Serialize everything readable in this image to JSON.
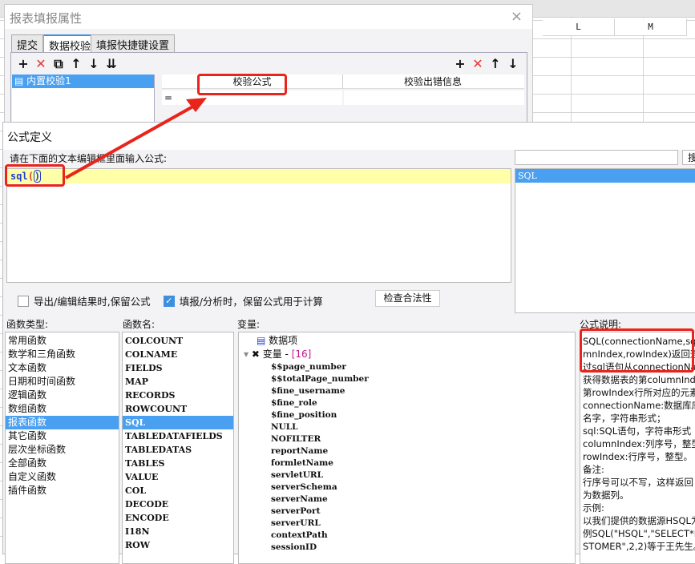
{
  "sheet": {
    "columns": [
      "L",
      "M"
    ],
    "left_col": "D"
  },
  "dialog1": {
    "title": "报表填报属性",
    "close": "×",
    "tabs": [
      "提交",
      "数据校验",
      "填报快捷键设置"
    ],
    "active_tab": 1,
    "left_list": [
      "内置校验1"
    ],
    "table_headers": [
      "校验公式",
      "校验出错信息"
    ],
    "row": [
      "=",
      ""
    ]
  },
  "dialog2": {
    "title": "公式定义",
    "prompt": "请在下面的文本编辑框里面输入公式:",
    "formula": "sql",
    "formula_paren_open": "(",
    "formula_paren_close": ")",
    "search_value": "",
    "search_button": "搜",
    "suggestions": [
      "SQL"
    ],
    "checkbox1": {
      "label": "导出/编辑结果时,保留公式",
      "checked": false
    },
    "checkbox2": {
      "label": "填报/分析时，保留公式用于计算",
      "checked": true
    },
    "check_button": "检查合法性",
    "labels": {
      "func_type": "函数类型:",
      "func_name": "函数名:",
      "variables": "变量:",
      "desc": "公式说明:"
    },
    "func_types": [
      "常用函数",
      "数学和三角函数",
      "文本函数",
      "日期和时间函数",
      "逻辑函数",
      "数组函数",
      "报表函数",
      "其它函数",
      "层次坐标函数",
      "全部函数",
      "自定义函数",
      "插件函数"
    ],
    "func_type_selected": 6,
    "func_names": [
      "COLCOUNT",
      "COLNAME",
      "FIELDS",
      "MAP",
      "RECORDS",
      "ROWCOUNT",
      "SQL",
      "TABLEDATAFIELDS",
      "TABLEDATAS",
      "TABLES",
      "VALUE",
      "COL",
      "DECODE",
      "ENCODE",
      "I18N",
      "ROW"
    ],
    "func_name_selected": 6,
    "tree_data_item": "数据项",
    "tree_var_node": "变量 - ",
    "tree_var_count": "[16]",
    "variables": [
      "$$page_number",
      "$$totalPage_number",
      "$fine_username",
      "$fine_role",
      "$fine_position",
      "NULL",
      "NOFILTER",
      "reportName",
      "formletName",
      "servletURL",
      "serverSchema",
      "serverName",
      "serverPort",
      "serverURL",
      "contextPath",
      "sessionID"
    ],
    "description": [
      "SQL(connectionName,sql,colu",
      "mnIndex,rowIndex)返回通",
      "过sql语句从connectionNa",
      "获得数据表的第columnIndex",
      "第rowIndex行所对应的元素",
      "connectionName:数据库库",
      "名字，字符串形式；",
      "sql:SQL语句，字符串形式",
      "columnIndex:列序号，整型",
      "rowIndex:行序号，整型。",
      "备注:",
      "行序号可以不写，这样返回",
      "为数据列。",
      "示例:",
      "以我们提供的数据源HSQL为",
      "例SQL(\"HSQL\",\"SELECT*FRO",
      "STOMER\",2,2)等于王先生。"
    ]
  },
  "colors": {
    "accent": "#4aa0f0",
    "highlight": "#e8241b",
    "editor_line": "#ffffa8"
  }
}
